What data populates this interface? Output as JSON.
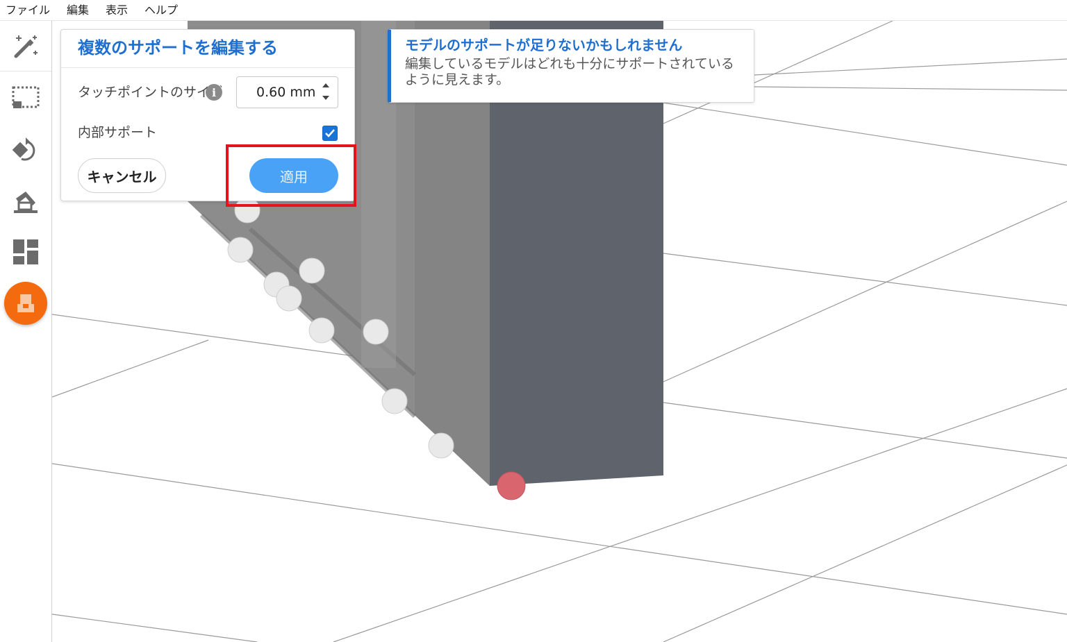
{
  "menu": [
    "ファイル",
    "編集",
    "表示",
    "ヘルプ"
  ],
  "toolbar": {
    "items": [
      {
        "name": "magic-wand-icon"
      },
      {
        "name": "selection-box-icon"
      },
      {
        "name": "rotate-icon"
      },
      {
        "name": "build-plate-icon"
      },
      {
        "name": "layout-icon"
      },
      {
        "name": "supports-icon",
        "active": true
      }
    ],
    "active_color": "#f46a0f"
  },
  "panel": {
    "title": "複数のサポートを編集する",
    "touch_point_label": "タッチポイントのサイズ",
    "touch_point_value": "0.60 mm",
    "internal_support_label": "内部サポート",
    "internal_support_checked": true,
    "cancel_label": "キャンセル",
    "apply_label": "適用",
    "accent": "#1f6fd1"
  },
  "warning": {
    "title": "モデルのサポートが足りないかもしれません",
    "body": "編集しているモデルはどれも十分にサポートされているように見えます。"
  }
}
